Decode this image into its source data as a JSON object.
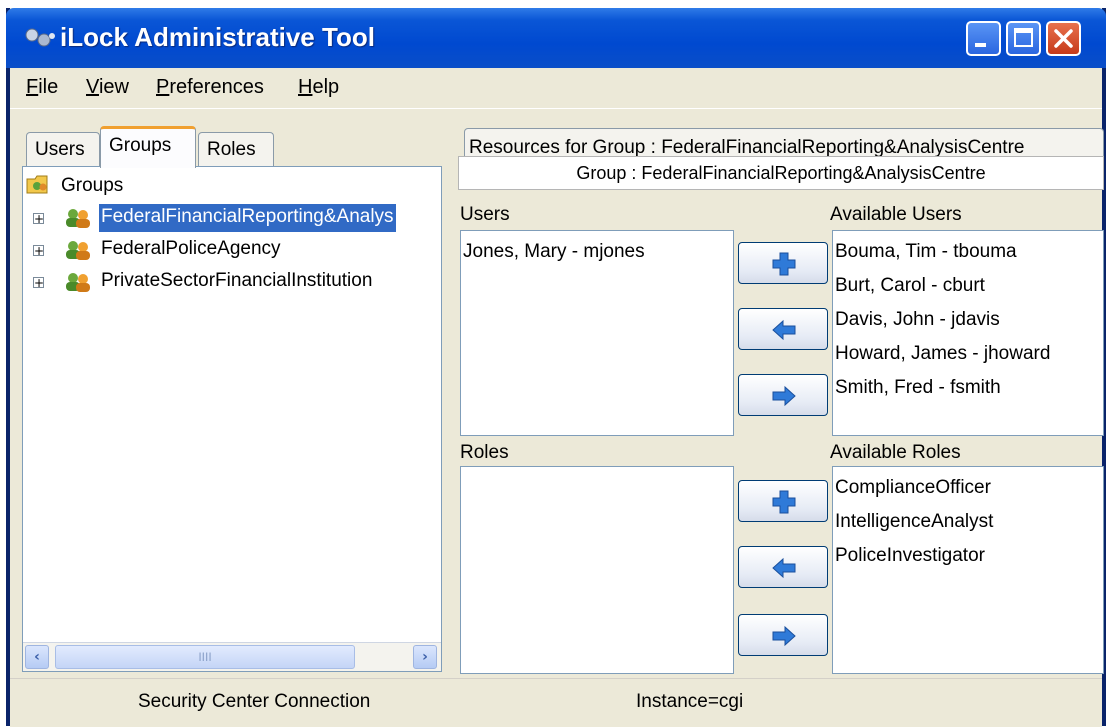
{
  "window": {
    "title": "iLock Administrative Tool",
    "title_icon": "users-icon"
  },
  "menu": [
    {
      "underline": "F",
      "rest": "ile"
    },
    {
      "underline": "V",
      "rest": "iew"
    },
    {
      "underline": "P",
      "rest": "references"
    },
    {
      "underline": "H",
      "rest": "elp"
    }
  ],
  "left_tabs": [
    "Users",
    "Groups",
    "Roles"
  ],
  "tree": {
    "root_label": "Groups",
    "items": [
      "FederalFinancialReporting&Analys",
      "FederalPoliceAgency",
      "PrivateSectorFinancialInstitution"
    ],
    "expand_symbol": "+",
    "scroll_thumb_grip": "IIII"
  },
  "resources_tab": "Resources for Group : FederalFinancialReporting&AnalysisCentre",
  "group_header": "Group : FederalFinancialReporting&AnalysisCentre",
  "users": {
    "label": "Users",
    "items": [
      "Jones, Mary  - mjones"
    ],
    "available_label": "Available Users",
    "available": [
      "Bouma, Tim  - tbouma",
      "Burt, Carol  - cburt",
      "Davis, John  - jdavis",
      "Howard, James  - jhoward",
      "Smith, Fred  - fsmith"
    ]
  },
  "roles": {
    "label": "Roles",
    "items": [],
    "available_label": "Available Roles",
    "available": [
      "ComplianceOfficer",
      "IntelligenceAnalyst",
      "PoliceInvestigator"
    ]
  },
  "status": {
    "connection": "Security Center Connection",
    "instance": "Instance=cgi"
  },
  "colors": {
    "titlebar": "#0a56d6",
    "selection": "#316ac5",
    "tab_accent": "#f0a030",
    "arrow_blue": "#2f7ad8"
  }
}
